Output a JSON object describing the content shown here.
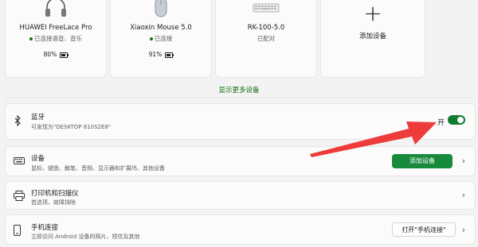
{
  "devices": [
    {
      "name": "HUAWEI FreeLace Pro",
      "status": "已连接语音、音乐",
      "battery": "80%",
      "icon": "headphones-icon",
      "battery_level": 0.8
    },
    {
      "name": "Xiaoxin Mouse 5.0",
      "status": "已连接",
      "battery": "91%",
      "icon": "mouse-icon",
      "battery_level": 0.91
    },
    {
      "name": "RK-100-5.0",
      "status": "已配对",
      "icon": "keyboard-icon"
    }
  ],
  "add_device_card": {
    "label": "添加设备",
    "icon": "plus-icon"
  },
  "show_more": "显示更多设备",
  "bluetooth": {
    "title": "蓝牙",
    "subtitle": "可发现为\"DESKTOP 810S2E8\"",
    "toggle_label": "开",
    "toggle_on": true,
    "icon": "bluetooth-icon"
  },
  "devices_row": {
    "title": "设备",
    "subtitle": "鼠标、键盘、触笔、音频、显示器和扩展坞、其他设备",
    "button": "添加设备",
    "icon": "keyboard-devices-icon"
  },
  "printers_row": {
    "title": "打印机和扫描仪",
    "subtitle": "首选项、故障排除",
    "icon": "printer-icon"
  },
  "phone_row": {
    "title": "手机连接",
    "subtitle": "立即访问 Android 设备的照片、短信及其他",
    "button": "打开\"手机连接\"",
    "icon": "phone-icon"
  },
  "colors": {
    "accent": "#0f7b2f",
    "annotation_arrow": "#ee3b3b"
  }
}
